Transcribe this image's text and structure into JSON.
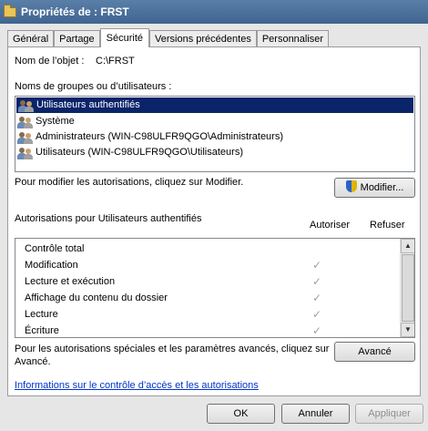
{
  "window": {
    "title": "Propriétés de : FRST"
  },
  "tabs": [
    {
      "label": "Général"
    },
    {
      "label": "Partage"
    },
    {
      "label": "Sécurité"
    },
    {
      "label": "Versions précédentes"
    },
    {
      "label": "Personnaliser"
    }
  ],
  "object": {
    "label": "Nom de l’objet :",
    "value": "C:\\FRST"
  },
  "groups": {
    "label": "Noms de groupes ou d’utilisateurs :",
    "items": [
      {
        "label": "Utilisateurs authentifiés",
        "selected": true
      },
      {
        "label": "Système"
      },
      {
        "label": "Administrateurs (WIN-C98ULFR9QGO\\Administrateurs)"
      },
      {
        "label": "Utilisateurs (WIN-C98ULFR9QGO\\Utilisateurs)"
      }
    ]
  },
  "modify": {
    "hint": "Pour modifier les autorisations, cliquez sur Modifier.",
    "button_label": "Modifier..."
  },
  "permissions": {
    "title": "Autorisations pour Utilisateurs authentifiés",
    "allow_header": "Autoriser",
    "deny_header": "Refuser",
    "check_glyph": "✓",
    "rows": [
      {
        "name": "Contrôle total",
        "allow": false
      },
      {
        "name": "Modification",
        "allow": true
      },
      {
        "name": "Lecture et exécution",
        "allow": true
      },
      {
        "name": "Affichage du contenu du dossier",
        "allow": true
      },
      {
        "name": "Lecture",
        "allow": true
      },
      {
        "name": "Écriture",
        "allow": true
      }
    ]
  },
  "advanced": {
    "hint_line1": "Pour les autorisations spéciales et les paramètres avancés, cliquez sur",
    "hint_line2": "Avancé.",
    "button_label": "Avancé"
  },
  "link": {
    "label": "Informations sur le contrôle d’accès et les autorisations"
  },
  "footer": {
    "ok_label": "OK",
    "cancel_label": "Annuler",
    "apply_label": "Appliquer"
  },
  "colors": {
    "titlebar": "#3e6590",
    "selection": "#0a246a",
    "link": "#0033cc"
  }
}
